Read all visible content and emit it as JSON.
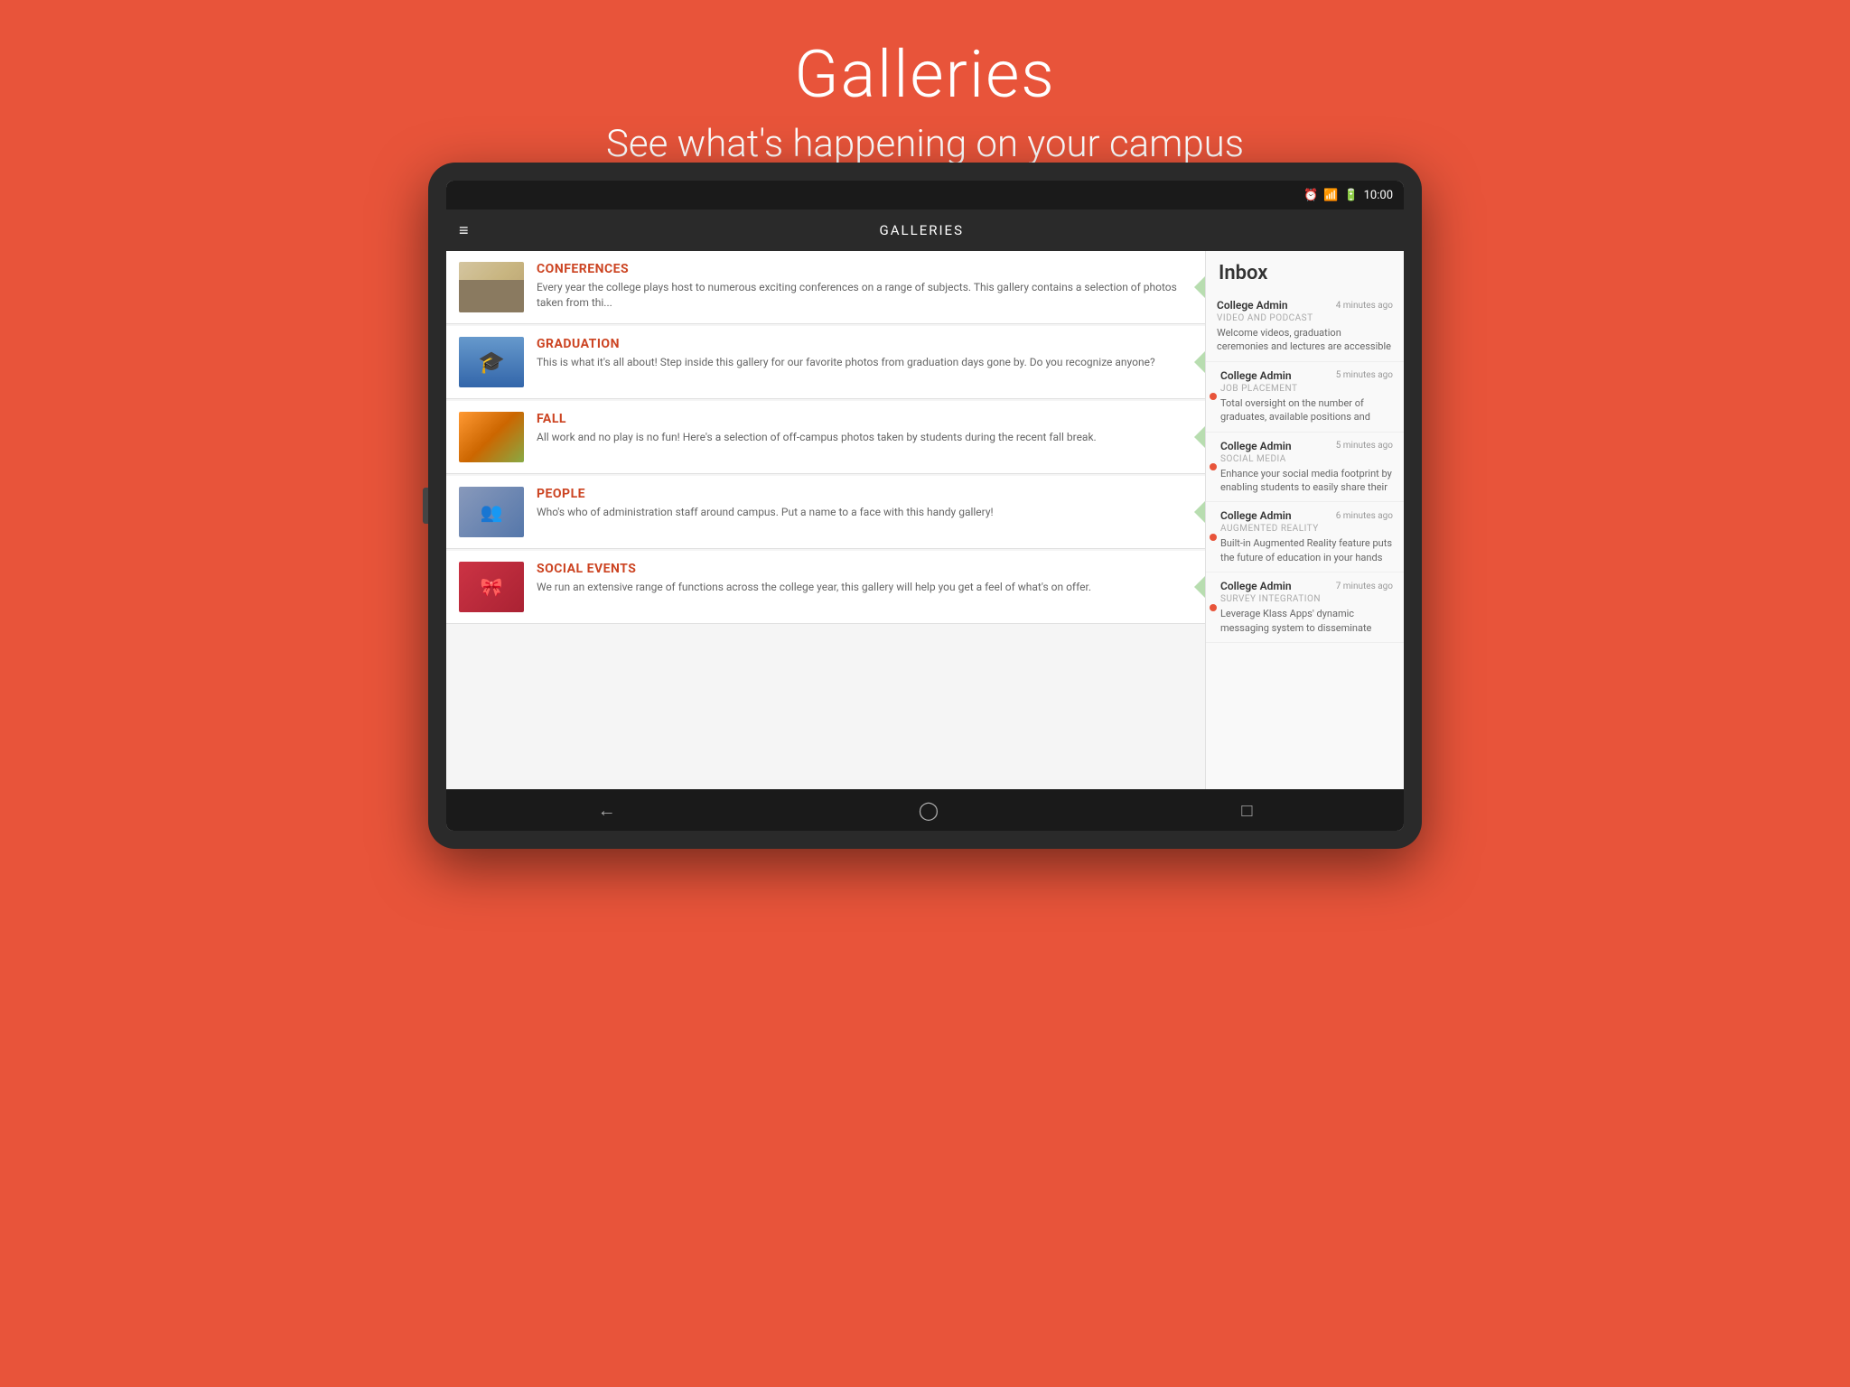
{
  "page": {
    "title": "Galleries",
    "subtitle": "See what's happening on your campus"
  },
  "statusBar": {
    "time": "10:00",
    "icons": [
      "alarm",
      "wifi",
      "battery"
    ]
  },
  "appBar": {
    "title": "GALLERIES"
  },
  "galleries": [
    {
      "id": "conferences",
      "title": "CONFERENCES",
      "description": "Every year the college plays host to numerous exciting conferences on a range of subjects.  This gallery contains a selection of photos taken from thi...",
      "thumb": "thumb-conferences"
    },
    {
      "id": "graduation",
      "title": "GRADUATION",
      "description": "This is what it's all about!  Step inside this gallery for our favorite photos from graduation days gone by.  Do you recognize anyone?",
      "thumb": "thumb-graduation"
    },
    {
      "id": "fall",
      "title": "FALL",
      "description": "All work and no play is no fun!  Here's a selection of off-campus photos taken by students during the recent fall break.",
      "thumb": "thumb-fall"
    },
    {
      "id": "people",
      "title": "PEOPLE",
      "description": "Who's who of administration staff around campus.  Put a name to a face with this handy gallery!",
      "thumb": "thumb-people"
    },
    {
      "id": "social-events",
      "title": "SOCIAL EVENTS",
      "description": "We run an extensive range of functions across the college year, this gallery will help you get a feel of what's on offer.",
      "thumb": "thumb-social"
    }
  ],
  "inbox": {
    "title": "Inbox",
    "items": [
      {
        "id": 1,
        "sender": "College Admin",
        "time": "4 minutes ago",
        "category": "VIDEO AND PODCAST",
        "preview": "Welcome videos, graduation ceremonies and lectures are accessible",
        "unread": false
      },
      {
        "id": 2,
        "sender": "College Admin",
        "time": "5 minutes ago",
        "category": "JOB PLACEMENT",
        "preview": "Total oversight on the number of graduates, available positions and",
        "unread": true
      },
      {
        "id": 3,
        "sender": "College Admin",
        "time": "5 minutes ago",
        "category": "SOCIAL MEDIA",
        "preview": "Enhance your social media footprint by enabling students to easily share their",
        "unread": true
      },
      {
        "id": 4,
        "sender": "College Admin",
        "time": "6 minutes ago",
        "category": "AUGMENTED REALITY",
        "preview": "Built-in Augmented Reality feature puts the future of education in your hands",
        "unread": true
      },
      {
        "id": 5,
        "sender": "College Admin",
        "time": "7 minutes ago",
        "category": "SURVEY INTEGRATION",
        "preview": "Leverage Klass Apps' dynamic messaging system to disseminate",
        "unread": true
      }
    ]
  },
  "bottomNav": {
    "back": "←",
    "home": "⌂",
    "recents": "▭"
  }
}
